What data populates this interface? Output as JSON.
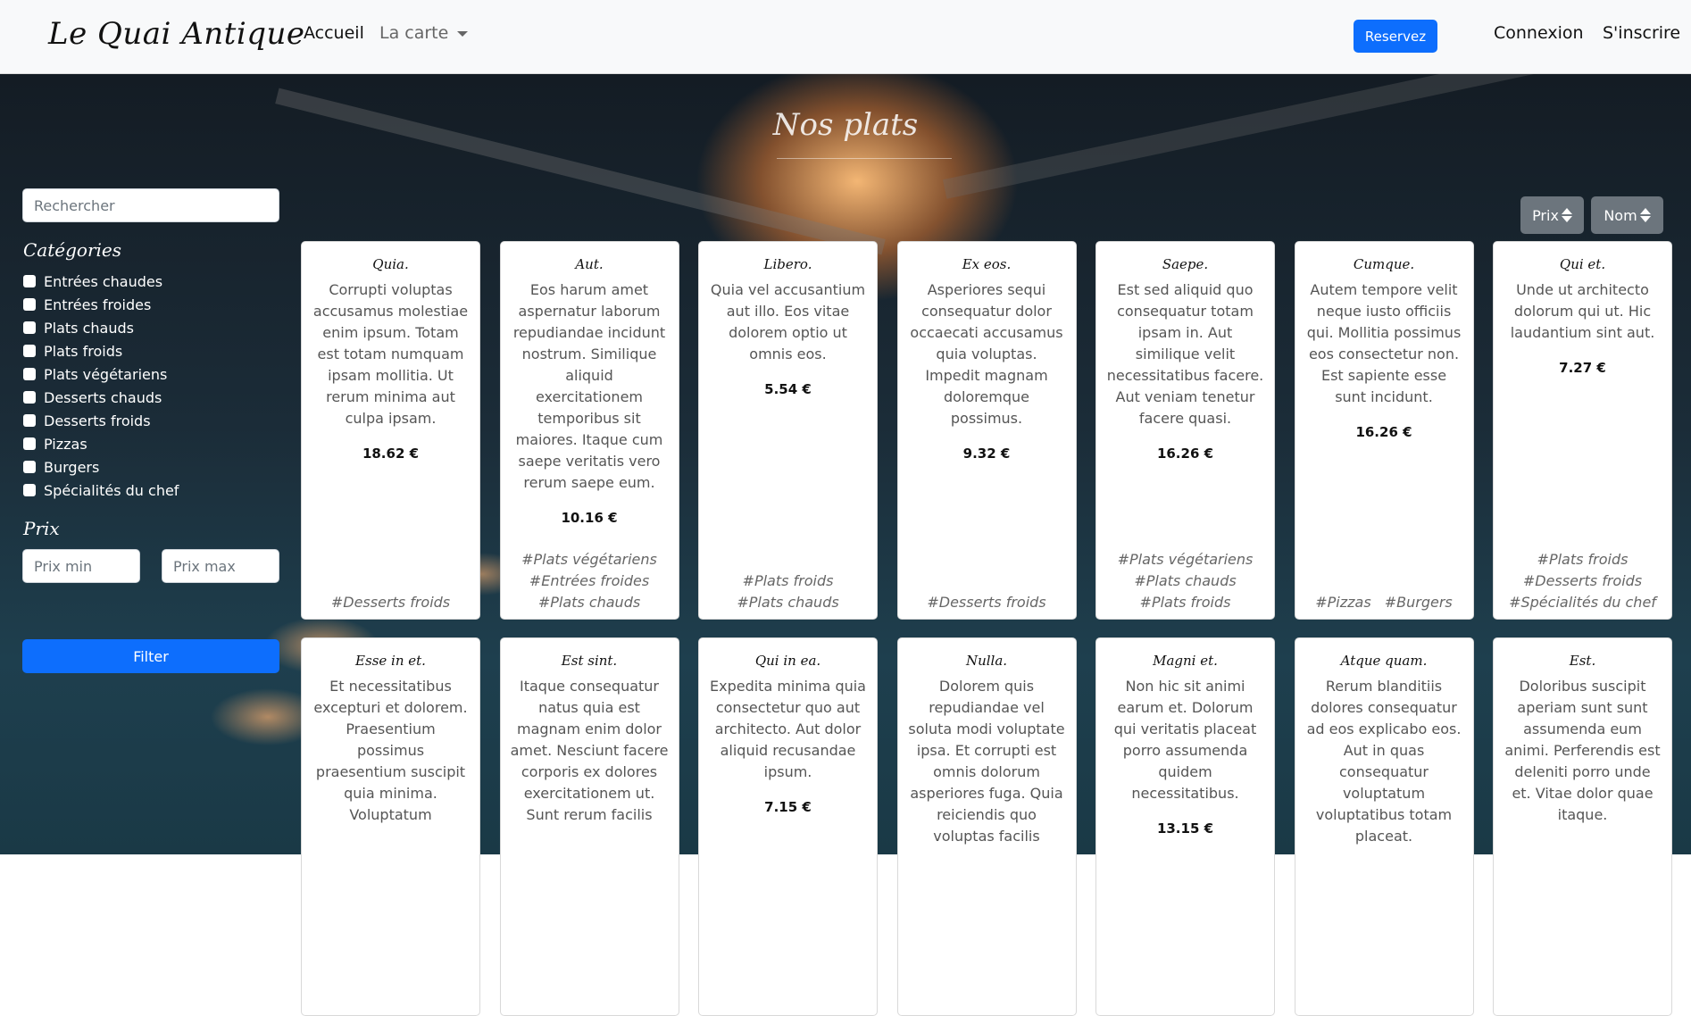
{
  "navbar": {
    "brand": "Le Quai Antique",
    "links": {
      "accueil": "Accueil",
      "carte": "La carte"
    },
    "reserve_label": "Reservez",
    "connexion": "Connexion",
    "inscrire": "S'inscrire"
  },
  "main": {
    "section_title": "Nos plats"
  },
  "sidebar": {
    "search_placeholder": "Rechercher",
    "categories_title": "Catégories",
    "categories": [
      "Entrées chaudes",
      "Entrées froides",
      "Plats chauds",
      "Plats froids",
      "Plats végétariens",
      "Desserts chauds",
      "Desserts froids",
      "Pizzas",
      "Burgers",
      "Spécialités du chef"
    ],
    "price_title": "Prix",
    "price_min_placeholder": "Prix min",
    "price_max_placeholder": "Prix max",
    "filter_label": "Filter"
  },
  "sort": {
    "price_label": "Prix",
    "name_label": "Nom"
  },
  "dishes": [
    {
      "title": "Quia.",
      "description": "Corrupti voluptas accusamus molestiae enim ipsum. Totam est totam numquam ipsam mollitia. Ut rerum minima aut culpa ipsam.",
      "price": "18.62 €",
      "tags": [
        "#Desserts froids"
      ]
    },
    {
      "title": "Aut.",
      "description": "Eos harum amet aspernatur laborum repudiandae incidunt nostrum. Similique aliquid exercitationem temporibus sit maiores. Itaque cum saepe veritatis vero rerum saepe eum.",
      "price": "10.16 €",
      "tags": [
        "#Plats végétariens",
        "#Entrées froides",
        "#Plats chauds"
      ]
    },
    {
      "title": "Libero.",
      "description": "Quia vel accusantium aut illo. Eos vitae dolorem optio ut omnis eos.",
      "price": "5.54 €",
      "tags": [
        "#Plats froids",
        "#Plats chauds"
      ]
    },
    {
      "title": "Ex eos.",
      "description": "Asperiores sequi consequatur dolor occaecati accusamus quia voluptas. Impedit magnam doloremque possimus.",
      "price": "9.32 €",
      "tags": [
        "#Desserts froids"
      ]
    },
    {
      "title": "Saepe.",
      "description": "Est sed aliquid quo consequatur totam ipsam in. Aut similique velit necessitatibus facere. Aut veniam tenetur facere quasi.",
      "price": "16.26 €",
      "tags": [
        "#Plats végétariens",
        "#Plats chauds",
        "#Plats froids"
      ]
    },
    {
      "title": "Cumque.",
      "description": "Autem tempore velit neque iusto officiis qui. Mollitia possimus eos consectetur non. Est sapiente esse sunt incidunt.",
      "price": "16.26 €",
      "tags": [
        "#Pizzas",
        "#Burgers"
      ]
    },
    {
      "title": "Qui et.",
      "description": "Unde ut architecto dolorum qui ut. Hic laudantium sint aut.",
      "price": "7.27 €",
      "tags": [
        "#Plats froids",
        "#Desserts froids",
        "#Spécialités du chef"
      ]
    },
    {
      "title": "Esse in et.",
      "description": "Et necessitatibus excepturi et dolorem. Praesentium possimus praesentium suscipit quia minima. Voluptatum",
      "price": "",
      "tags": []
    },
    {
      "title": "Est sint.",
      "description": "Itaque consequatur natus quia est magnam enim dolor amet. Nesciunt facere corporis ex dolores exercitationem ut. Sunt rerum facilis",
      "price": "",
      "tags": []
    },
    {
      "title": "Qui in ea.",
      "description": "Expedita minima quia consectetur quo aut architecto. Aut dolor aliquid recusandae ipsum.",
      "price": "7.15 €",
      "tags": []
    },
    {
      "title": "Nulla.",
      "description": "Dolorem quis repudiandae vel soluta modi voluptate ipsa. Et corrupti est omnis dolorum asperiores fuga. Quia reiciendis quo voluptas facilis",
      "price": "",
      "tags": []
    },
    {
      "title": "Magni et.",
      "description": "Non hic sit animi earum et. Dolorum qui veritatis placeat porro assumenda quidem necessitatibus.",
      "price": "13.15 €",
      "tags": []
    },
    {
      "title": "Atque quam.",
      "description": "Rerum blanditiis dolores consequatur ad eos explicabo eos. Aut in quas consequatur voluptatum voluptatibus totam placeat.",
      "price": "",
      "tags": []
    },
    {
      "title": "Est.",
      "description": "Doloribus suscipit aperiam sunt sunt assumenda eum animi. Perferendis est deleniti porro unde et. Vitae dolor quae itaque.",
      "price": "",
      "tags": []
    }
  ],
  "icons": {
    "carte_dropdown": "chevron-down-icon",
    "sort": "sort-icon",
    "exit": "exit-sign-icon"
  },
  "colors": {
    "primary": "#0d6efd",
    "secondary": "#6c757d",
    "navbar_bg": "#f8f9fa"
  }
}
